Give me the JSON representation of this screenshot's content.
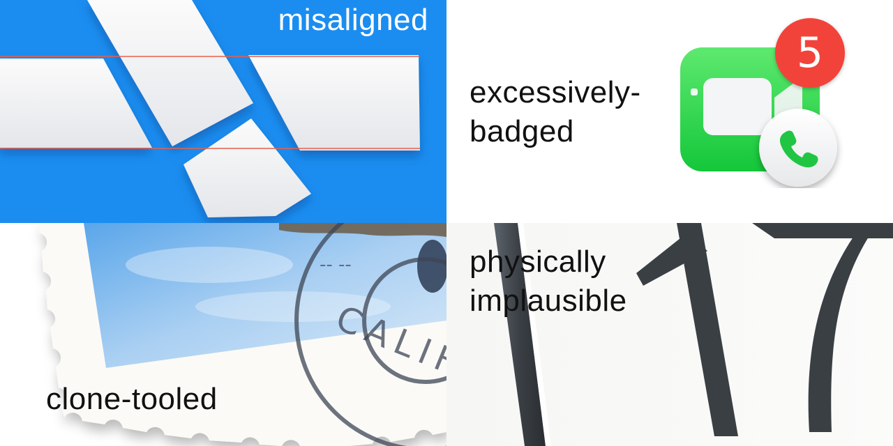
{
  "panels": {
    "misaligned": {
      "caption": "misaligned",
      "icon": "xcode-tiles-icon"
    },
    "excessively_badged": {
      "caption_lines": [
        "excessively-",
        "badged"
      ],
      "icon": "facetime-icon",
      "badge_count": "5"
    },
    "clone_tooled": {
      "caption": "clone-tooled",
      "icon": "mail-stamp-icon",
      "postmark_text": "CALIF",
      "postmark_dashes": "-- --"
    },
    "physically_implausible": {
      "caption_lines": [
        "physically",
        "implausible"
      ],
      "icon": "calendar-icon",
      "calendar_day": "17"
    }
  },
  "colors": {
    "xcode_blue": "#1b8df0",
    "guide_line_red": "#e8604a",
    "facetime_green": "#2bd44b",
    "badge_red": "#f2433a",
    "calendar_dark": "#3a3f44"
  }
}
